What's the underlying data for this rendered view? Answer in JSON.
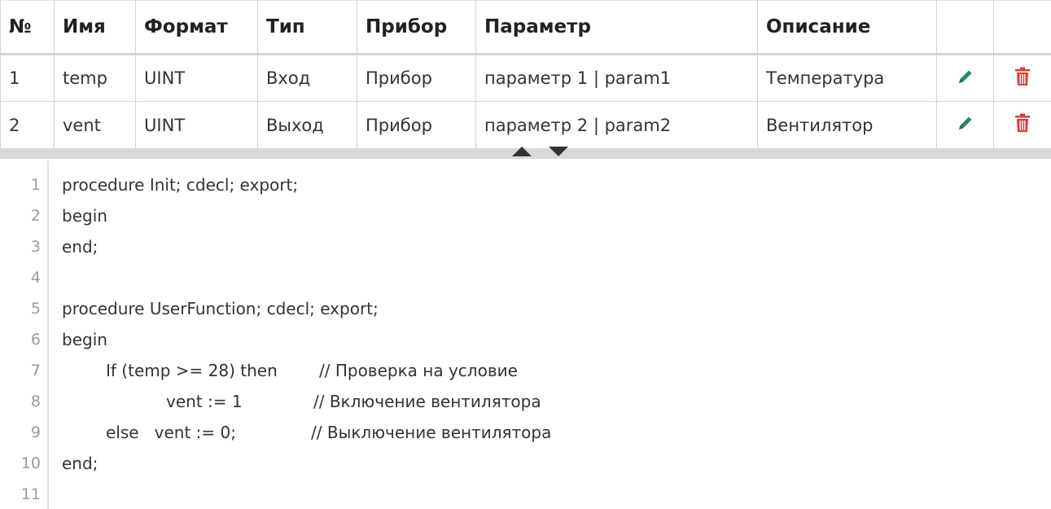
{
  "table": {
    "headers": [
      "№",
      "Имя",
      "Формат",
      "Тип",
      "Прибор",
      "Параметр",
      "Описание"
    ],
    "rows": [
      {
        "num": "1",
        "name": "temp",
        "format": "UINT",
        "type": "Вход",
        "device": "Прибор",
        "param": "параметр 1 | param1",
        "desc": "Температура"
      },
      {
        "num": "2",
        "name": "vent",
        "format": "UINT",
        "type": "Выход",
        "device": "Прибор",
        "param": "параметр 2 | param2",
        "desc": "Вентилятор"
      }
    ],
    "edit_icon": "pencil-icon",
    "delete_icon": "trash-icon",
    "colors": {
      "edit": "#1f8a70",
      "delete": "#e53935"
    }
  },
  "splitter": {
    "up_icon": "triangle-up-icon",
    "down_icon": "triangle-down-icon"
  },
  "editor": {
    "line_numbers": [
      "1",
      "2",
      "3",
      "4",
      "5",
      "6",
      "7",
      "8",
      "9",
      "10",
      "11"
    ],
    "lines": [
      {
        "code": "procedure Init; cdecl; export;",
        "comment": ""
      },
      {
        "code": "begin",
        "comment": ""
      },
      {
        "code": "end;",
        "comment": ""
      },
      {
        "code": "",
        "comment": ""
      },
      {
        "code": "procedure UserFunction; cdecl; export;",
        "comment": ""
      },
      {
        "code": "begin",
        "comment": ""
      },
      {
        "code": "If (temp >= 28) then",
        "comment": "// Проверка на условие"
      },
      {
        "code": "vent := 1",
        "comment": "// Включение вентилятора"
      },
      {
        "code": "else   vent := 0;",
        "comment": "// Выключение вентилятора"
      },
      {
        "code": "end;",
        "comment": ""
      },
      {
        "code": "",
        "comment": ""
      }
    ]
  }
}
